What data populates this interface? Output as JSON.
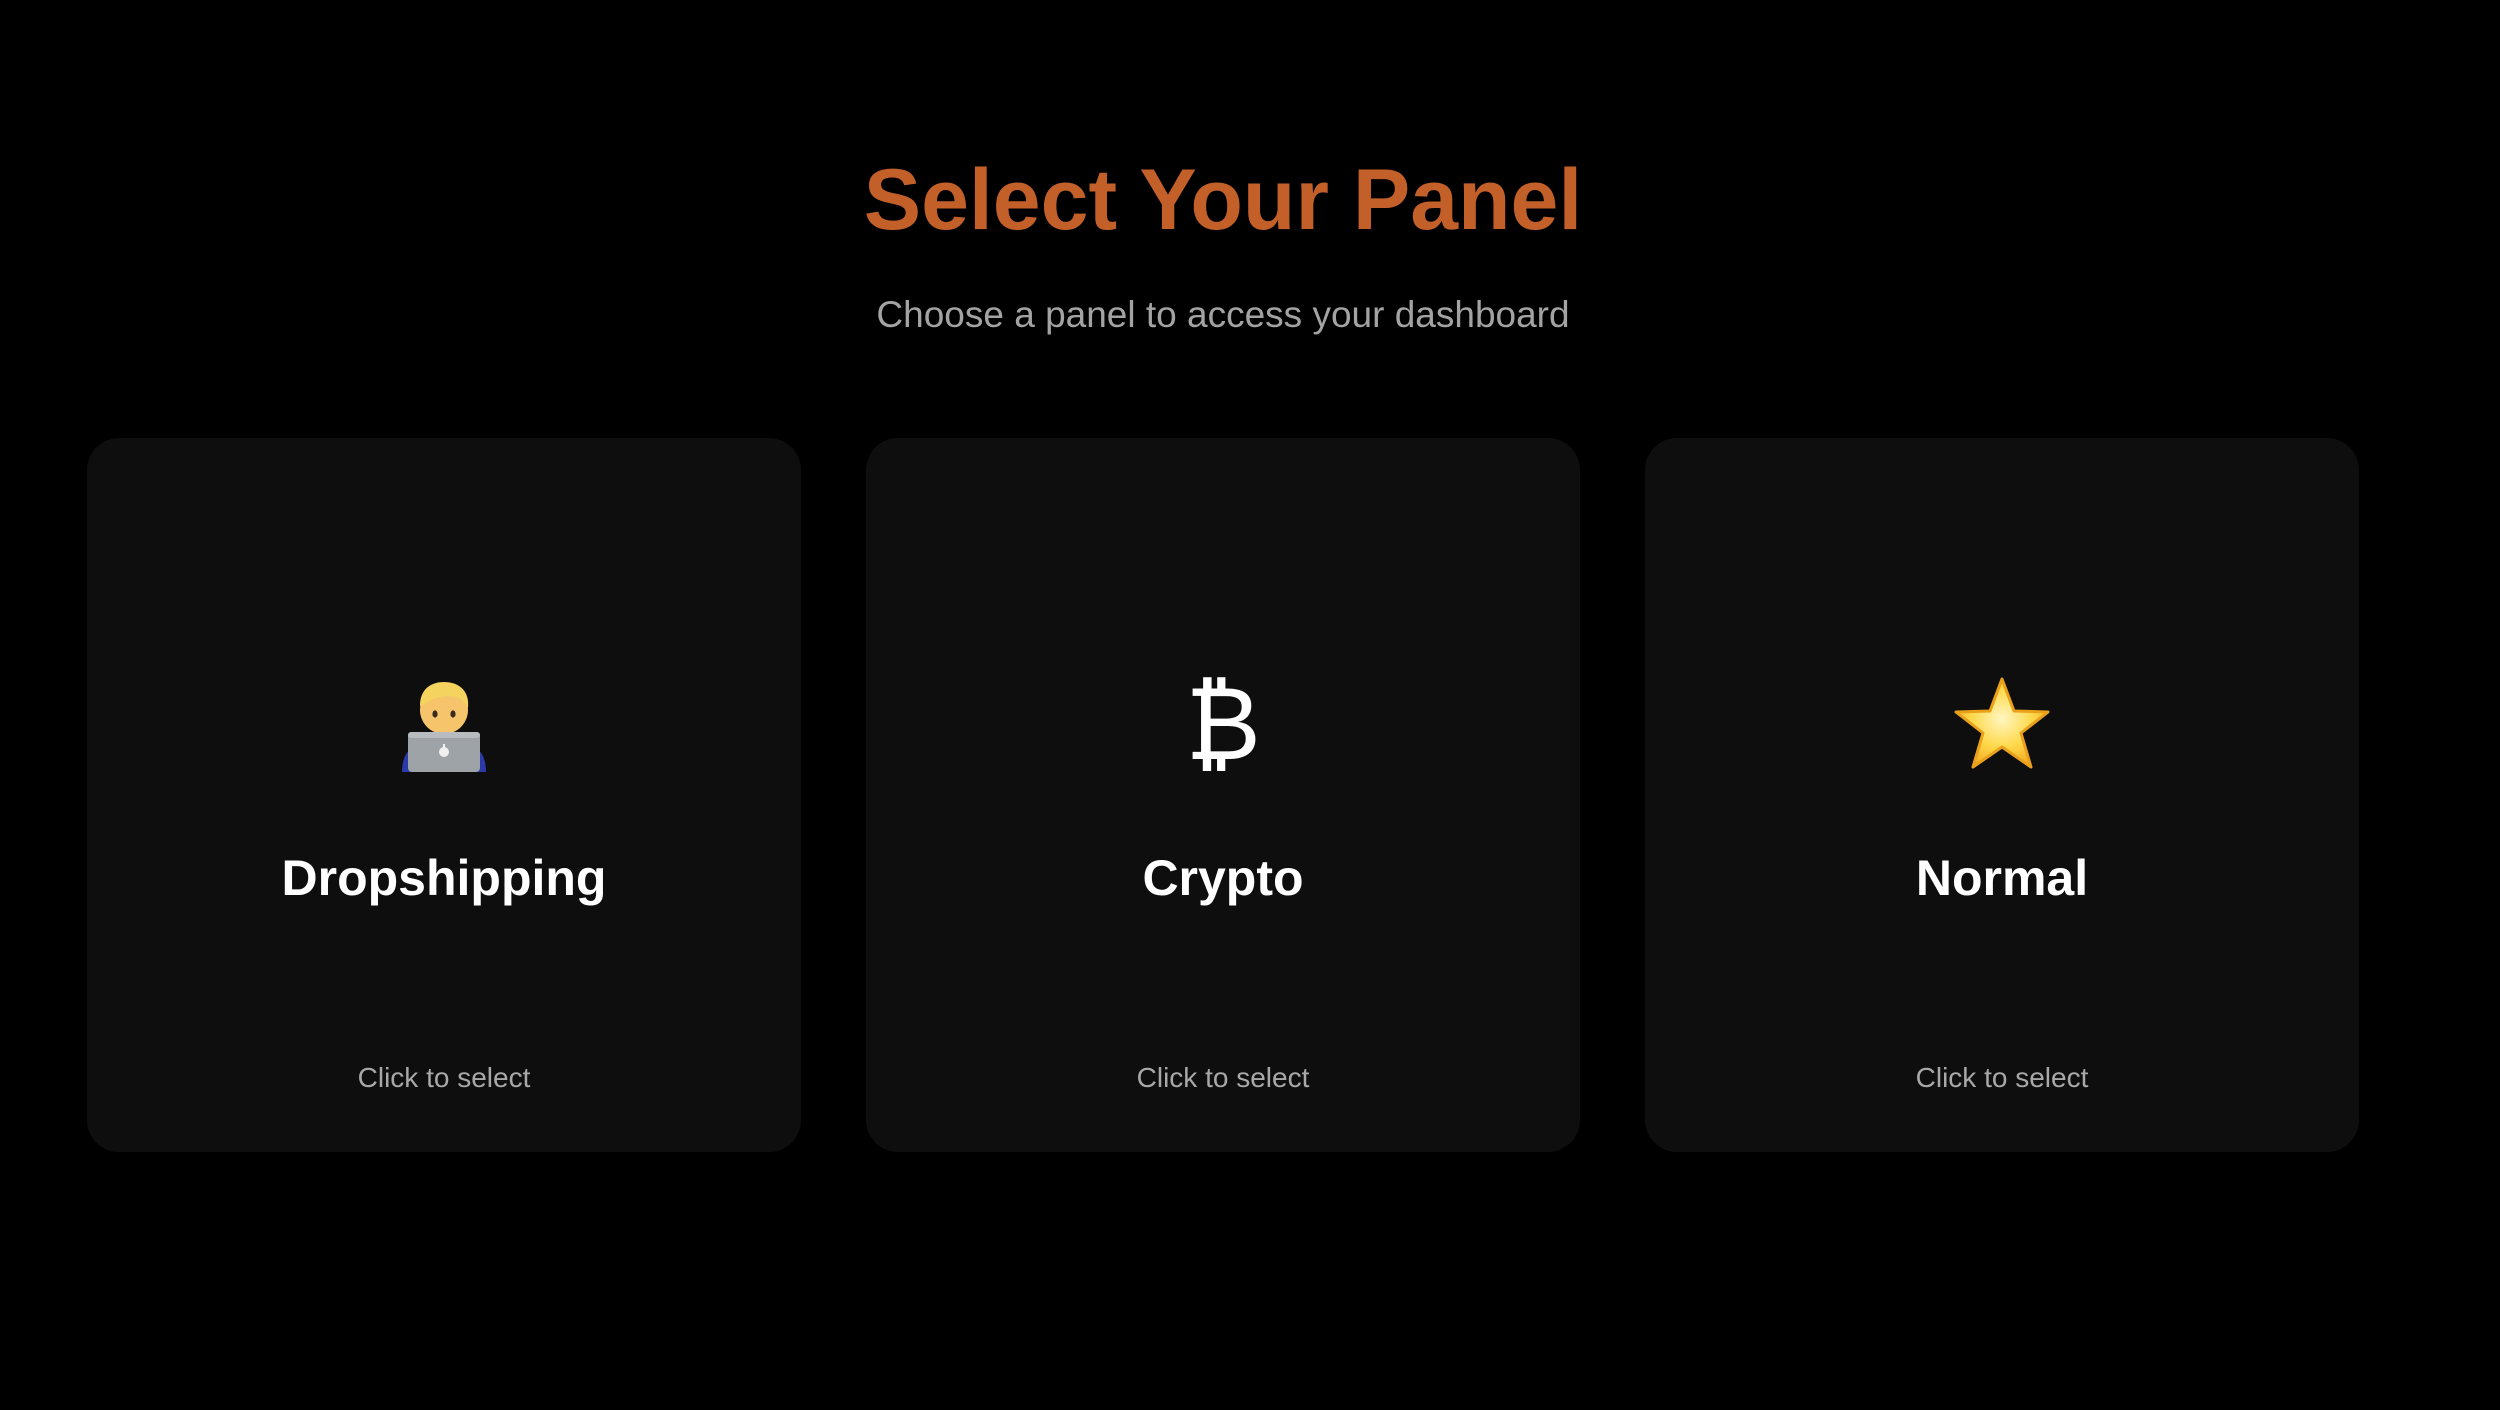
{
  "header": {
    "title": "Select Your Panel",
    "subtitle": "Choose a panel to access your dashboard"
  },
  "panels": [
    {
      "name": "Dropshipping",
      "icon": "technologist-icon",
      "hint": "Click to select"
    },
    {
      "name": "Crypto",
      "icon": "bitcoin-icon",
      "icon_glyph": "₿",
      "hint": "Click to select"
    },
    {
      "name": "Normal",
      "icon": "star-icon",
      "hint": "Click to select"
    }
  ],
  "colors": {
    "background": "#000000",
    "card": "#0e0e0e",
    "accent": "#c3602a",
    "muted_text": "#a3a3a3"
  }
}
